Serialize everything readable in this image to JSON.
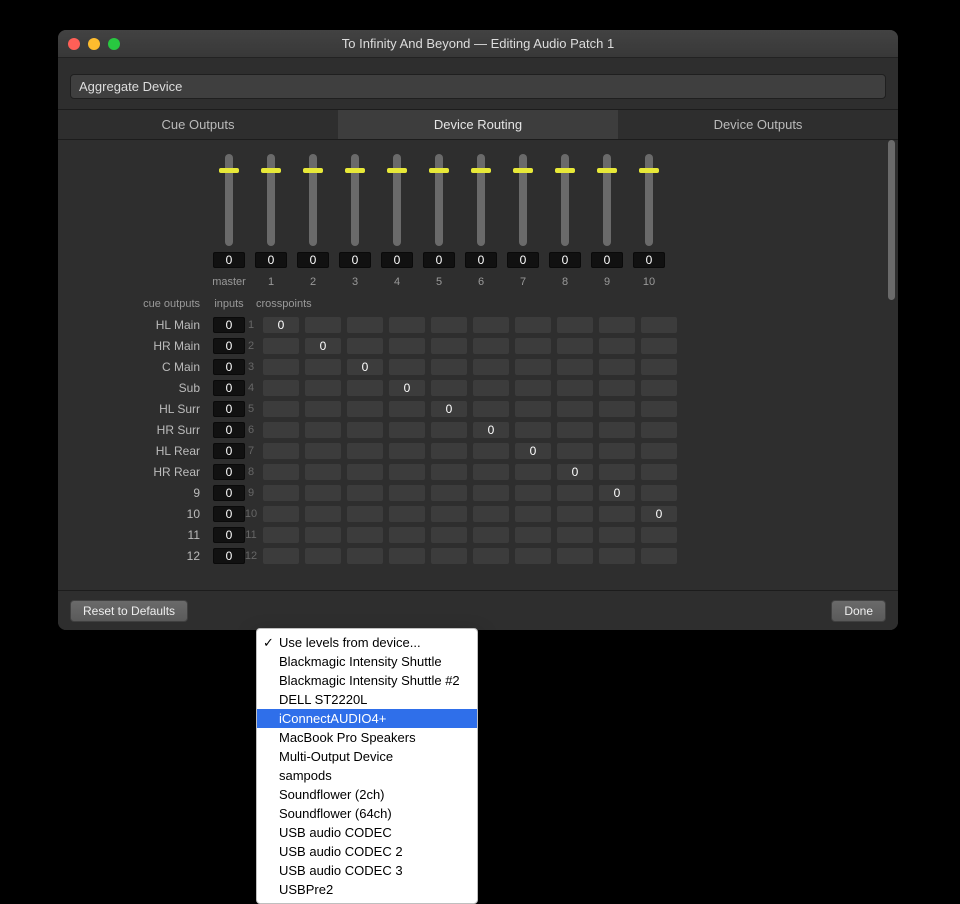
{
  "window": {
    "title": "To Infinity And Beyond — Editing Audio Patch 1",
    "device_name": "Aggregate Device"
  },
  "tabs": [
    {
      "label": "Cue Outputs",
      "active": false
    },
    {
      "label": "Device Routing",
      "active": true
    },
    {
      "label": "Device Outputs",
      "active": false
    }
  ],
  "channels": [
    {
      "label": "master",
      "value": "0",
      "thumb_pct": 14
    },
    {
      "label": "1",
      "value": "0",
      "thumb_pct": 14
    },
    {
      "label": "2",
      "value": "0",
      "thumb_pct": 14
    },
    {
      "label": "3",
      "value": "0",
      "thumb_pct": 14
    },
    {
      "label": "4",
      "value": "0",
      "thumb_pct": 14
    },
    {
      "label": "5",
      "value": "0",
      "thumb_pct": 14
    },
    {
      "label": "6",
      "value": "0",
      "thumb_pct": 14
    },
    {
      "label": "7",
      "value": "0",
      "thumb_pct": 14
    },
    {
      "label": "8",
      "value": "0",
      "thumb_pct": 14
    },
    {
      "label": "9",
      "value": "0",
      "thumb_pct": 14
    },
    {
      "label": "10",
      "value": "0",
      "thumb_pct": 14
    }
  ],
  "headers": {
    "cue_outputs": "cue outputs",
    "inputs": "inputs",
    "crosspoints": "crosspoints"
  },
  "rows": [
    {
      "name": "HL Main",
      "input": "0",
      "num": "1",
      "cp": [
        "0",
        "",
        "",
        "",
        "",
        "",
        "",
        "",
        "",
        ""
      ]
    },
    {
      "name": "HR Main",
      "input": "0",
      "num": "2",
      "cp": [
        "",
        "0",
        "",
        "",
        "",
        "",
        "",
        "",
        "",
        ""
      ]
    },
    {
      "name": "C Main",
      "input": "0",
      "num": "3",
      "cp": [
        "",
        "",
        "0",
        "",
        "",
        "",
        "",
        "",
        "",
        ""
      ]
    },
    {
      "name": "Sub",
      "input": "0",
      "num": "4",
      "cp": [
        "",
        "",
        "",
        "0",
        "",
        "",
        "",
        "",
        "",
        ""
      ]
    },
    {
      "name": "HL Surr",
      "input": "0",
      "num": "5",
      "cp": [
        "",
        "",
        "",
        "",
        "0",
        "",
        "",
        "",
        "",
        ""
      ]
    },
    {
      "name": "HR Surr",
      "input": "0",
      "num": "6",
      "cp": [
        "",
        "",
        "",
        "",
        "",
        "0",
        "",
        "",
        "",
        ""
      ]
    },
    {
      "name": "HL Rear",
      "input": "0",
      "num": "7",
      "cp": [
        "",
        "",
        "",
        "",
        "",
        "",
        "0",
        "",
        "",
        ""
      ]
    },
    {
      "name": "HR Rear",
      "input": "0",
      "num": "8",
      "cp": [
        "",
        "",
        "",
        "",
        "",
        "",
        "",
        "0",
        "",
        ""
      ]
    },
    {
      "name": "9",
      "input": "0",
      "num": "9",
      "cp": [
        "",
        "",
        "",
        "",
        "",
        "",
        "",
        "",
        "0",
        ""
      ]
    },
    {
      "name": "10",
      "input": "0",
      "num": "10",
      "cp": [
        "",
        "",
        "",
        "",
        "",
        "",
        "",
        "",
        "",
        "0"
      ]
    },
    {
      "name": "11",
      "input": "0",
      "num": "11",
      "cp": [
        "",
        "",
        "",
        "",
        "",
        "",
        "",
        "",
        "",
        ""
      ]
    },
    {
      "name": "12",
      "input": "0",
      "num": "12",
      "cp": [
        "",
        "",
        "",
        "",
        "",
        "",
        "",
        "",
        "",
        ""
      ]
    }
  ],
  "footer": {
    "reset": "Reset to Defaults",
    "done": "Done"
  },
  "menu": {
    "title": "Use levels from device...",
    "items": [
      "Blackmagic Intensity Shuttle",
      "Blackmagic Intensity Shuttle #2",
      "DELL ST2220L",
      "iConnectAUDIO4+",
      "MacBook Pro Speakers",
      "Multi-Output Device",
      "sampods",
      "Soundflower (2ch)",
      "Soundflower (64ch)",
      "USB audio CODEC",
      "USB audio CODEC 2",
      "USB audio CODEC 3",
      "USBPre2"
    ],
    "selected_index": 3
  }
}
